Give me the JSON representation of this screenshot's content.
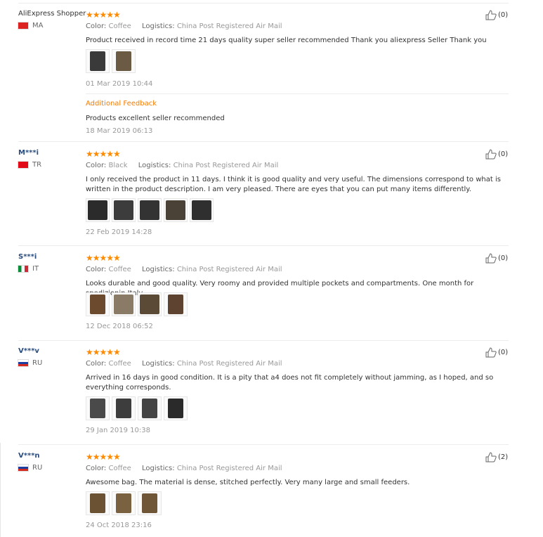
{
  "logistics_label": "Logistics:",
  "color_label": "Color:",
  "reviews": [
    {
      "user": "AliExpress Shopper",
      "country": "MA",
      "stars": "★★★★★",
      "color": "Coffee",
      "logistics": "China Post Registered Air Mail",
      "text": "Product received in record time 21 days quality super seller recommended Thank you aliexpress Seller Thank you",
      "date": "01 Mar 2019 10:44",
      "helpful": "(0)",
      "additional": {
        "title": "Additional Feedback",
        "text": "Products excellent seller recommended",
        "date": "18 Mar 2019 06:13"
      },
      "photo_colors": [
        "#3a3a3a",
        "#6b5a44"
      ]
    },
    {
      "user": "M***i",
      "country": "TR",
      "stars": "★★★★★",
      "color": "Black",
      "logistics": "China Post Registered Air Mail",
      "text": "I only received the product in 11 days. I think it is good quality and very useful. The dimensions correspond to what is written in the product description. I am very pleased. There are eyes that you can put many items differently.",
      "date": "22 Feb 2019 14:28",
      "helpful": "(0)",
      "photo_colors": [
        "#2b2b2b",
        "#3c3c3c",
        "#333333",
        "#4a4237",
        "#2f2f2f"
      ]
    },
    {
      "user": "S***i",
      "country": "IT",
      "stars": "★★★★★",
      "color": "Coffee",
      "logistics": "China Post Registered Air Mail",
      "text": "Looks durable and good quality. Very roomy and provided multiple pockets and compartments. One month for spedizionin Italy",
      "date": "12 Dec 2018 06:52",
      "helpful": "(0)",
      "photo_colors": [
        "#6b4a2e",
        "#8a7b66",
        "#5a4a36",
        "#5e4330"
      ]
    },
    {
      "user": "V***v",
      "country": "RU",
      "stars": "★★★★★",
      "color": "Coffee",
      "logistics": "China Post Registered Air Mail",
      "text": "Arrived in 16 days in good condition. It is a pity that a4 does not fit completely without jamming, as I hoped, and so everything corresponds.",
      "date": "29 Jan 2019 10:38",
      "helpful": "(0)",
      "photo_colors": [
        "#4a4a4a",
        "#3d3d3d",
        "#444444",
        "#2a2a2a"
      ]
    },
    {
      "user": "V***n",
      "country": "RU",
      "stars": "★★★★★",
      "color": "Coffee",
      "logistics": "China Post Registered Air Mail",
      "text": "Awesome bag. The material is dense, stitched perfectly. Very many large and small feeders.",
      "date": "24 Oct 2018 23:16",
      "helpful": "(2)",
      "photo_colors": [
        "#6a5233",
        "#7a6240",
        "#6e5637"
      ]
    }
  ]
}
